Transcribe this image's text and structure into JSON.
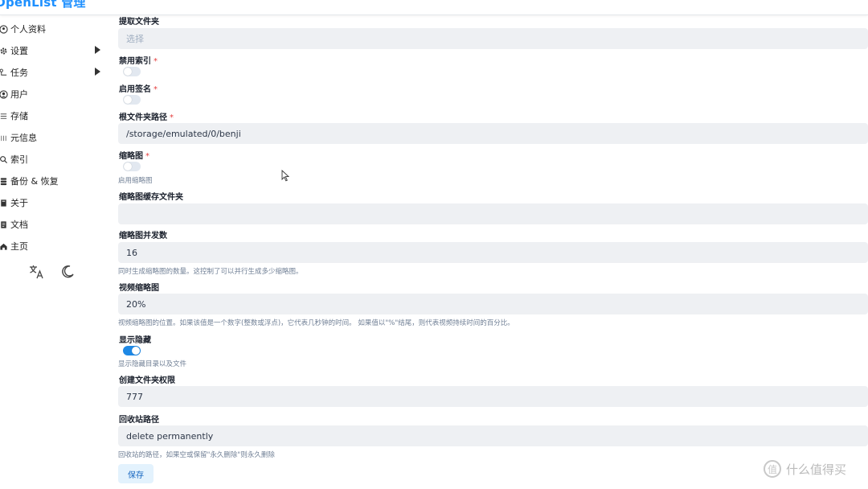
{
  "header": {
    "app_title": "OpenList 管理"
  },
  "sidebar": {
    "items": [
      {
        "label": "个人资料",
        "icon": "user-card-icon"
      },
      {
        "label": "设置",
        "icon": "gear-icon"
      },
      {
        "label": "任务",
        "icon": "tasks-icon"
      },
      {
        "label": "用户",
        "icon": "user-icon"
      },
      {
        "label": "存储",
        "icon": "storage-icon"
      },
      {
        "label": "元信息",
        "icon": "meta-icon"
      },
      {
        "label": "索引",
        "icon": "search-icon"
      },
      {
        "label": "备份 & 恢复",
        "icon": "database-icon"
      },
      {
        "label": "关于",
        "icon": "book-icon"
      },
      {
        "label": "文档",
        "icon": "document-icon"
      },
      {
        "label": "主页",
        "icon": "home-icon"
      }
    ],
    "tools": {
      "language_icon": "translate-icon",
      "theme_icon": "moon-icon"
    }
  },
  "form": {
    "extract_folder": {
      "label": "提取文件夹",
      "placeholder": "选择"
    },
    "disable_index": {
      "label": "禁用索引",
      "required": "*",
      "enabled": false
    },
    "enable_sign": {
      "label": "启用签名",
      "required": "*",
      "enabled": false
    },
    "root_path": {
      "label": "根文件夹路径",
      "required": "*",
      "value": "/storage/emulated/0/benji"
    },
    "thumbnail": {
      "label": "缩略图",
      "required": "*",
      "enabled": false,
      "help": "启用缩略图"
    },
    "thumbnail_cache_folder": {
      "label": "缩略图缓存文件夹",
      "value": ""
    },
    "thumbnail_concurrency": {
      "label": "缩略图并发数",
      "value": "16",
      "help": "同时生成缩略图的数量。这控制了可以并行生成多少缩略图。"
    },
    "video_thumbnail": {
      "label": "视频缩略图",
      "value": "20%",
      "help": "视频缩略图的位置。如果该值是一个数字(整数或浮点)，它代表几秒钟的时间。 如果值以\"%\"结尾，则代表视频持续时间的百分比。"
    },
    "show_hidden": {
      "label": "显示隐藏",
      "enabled": true,
      "help": "显示隐藏目录以及文件"
    },
    "mkdir_perm": {
      "label": "创建文件夹权限",
      "value": "777"
    },
    "recycle_bin": {
      "label": "回收站路径",
      "value": "delete permanently",
      "help": "回收站的路径，如果空或保留\"永久删除\"则永久删除"
    },
    "save_label": "保存"
  },
  "watermark": {
    "icon": "zhi-badge-icon",
    "badge_char": "值",
    "text": "什么值得买"
  },
  "colors": {
    "accent": "#1e88e5",
    "input_bg": "#eef0f3"
  }
}
